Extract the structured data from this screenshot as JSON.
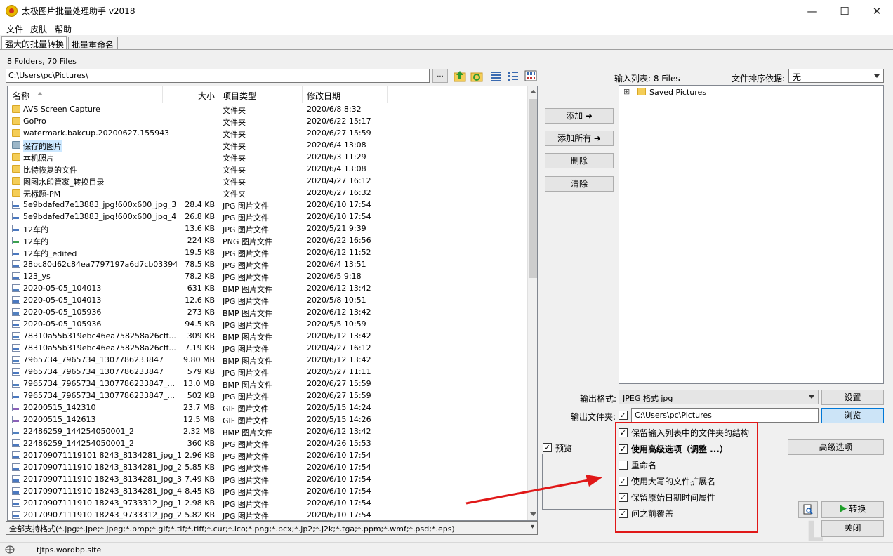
{
  "window": {
    "title": "太极图片批量处理助手  v2018",
    "minimize": "—",
    "maximize": "☐",
    "close": "✕"
  },
  "menu": [
    "文件",
    "皮肤",
    "帮助"
  ],
  "tabs": [
    "强大的批量转换",
    "批量重命名"
  ],
  "file_count": "8 Folders, 70 Files",
  "path": "C:\\Users\\pc\\Pictures\\",
  "browse_small": "...",
  "list": {
    "headers": {
      "name": "名称",
      "size": "大小",
      "type": "项目类型",
      "date": "修改日期"
    },
    "rows": [
      {
        "name": "AVS Screen Capture",
        "size": "",
        "type": "文件夹",
        "date": "2020/6/8 8:32",
        "icon": "folder"
      },
      {
        "name": "GoPro",
        "size": "",
        "type": "文件夹",
        "date": "2020/6/22 15:17",
        "icon": "folder"
      },
      {
        "name": "watermark.bakcup.20200627.155943",
        "size": "",
        "type": "文件夹",
        "date": "2020/6/27 15:59",
        "icon": "folder"
      },
      {
        "name": "保存的图片",
        "size": "",
        "type": "文件夹",
        "date": "2020/6/4 13:08",
        "icon": "folder-grey",
        "selected": true
      },
      {
        "name": "本机照片",
        "size": "",
        "type": "文件夹",
        "date": "2020/6/3 11:29",
        "icon": "folder"
      },
      {
        "name": "比特恢复的文件",
        "size": "",
        "type": "文件夹",
        "date": "2020/6/4 13:08",
        "icon": "folder"
      },
      {
        "name": "图图水印管家_转换目录",
        "size": "",
        "type": "文件夹",
        "date": "2020/4/27 16:12",
        "icon": "folder"
      },
      {
        "name": "无标题-PM",
        "size": "",
        "type": "文件夹",
        "date": "2020/6/27 16:32",
        "icon": "folder"
      },
      {
        "name": "5e9bdafed7e13883_jpg!600x600_jpg_3",
        "size": "28.4 KB",
        "type": "JPG 图片文件",
        "date": "2020/6/10 17:54",
        "icon": "img"
      },
      {
        "name": "5e9bdafed7e13883_jpg!600x600_jpg_4",
        "size": "26.8 KB",
        "type": "JPG 图片文件",
        "date": "2020/6/10 17:54",
        "icon": "img"
      },
      {
        "name": "12车的",
        "size": "13.6 KB",
        "type": "JPG 图片文件",
        "date": "2020/5/21 9:39",
        "icon": "img"
      },
      {
        "name": "12车的",
        "size": "224 KB",
        "type": "PNG 图片文件",
        "date": "2020/6/22 16:56",
        "icon": "png"
      },
      {
        "name": "12车的_edited",
        "size": "19.5 KB",
        "type": "JPG 图片文件",
        "date": "2020/6/12 11:52",
        "icon": "img"
      },
      {
        "name": "28bc80d62c84ea7797197a6d7cb03394",
        "size": "78.5 KB",
        "type": "JPG 图片文件",
        "date": "2020/6/4 13:51",
        "icon": "img"
      },
      {
        "name": "123_ys",
        "size": "78.2 KB",
        "type": "JPG 图片文件",
        "date": "2020/6/5 9:18",
        "icon": "img"
      },
      {
        "name": "2020-05-05_104013",
        "size": "631 KB",
        "type": "BMP 图片文件",
        "date": "2020/6/12 13:42",
        "icon": "bmp"
      },
      {
        "name": "2020-05-05_104013",
        "size": "12.6 KB",
        "type": "JPG 图片文件",
        "date": "2020/5/8 10:51",
        "icon": "img"
      },
      {
        "name": "2020-05-05_105936",
        "size": "273 KB",
        "type": "BMP 图片文件",
        "date": "2020/6/12 13:42",
        "icon": "bmp"
      },
      {
        "name": "2020-05-05_105936",
        "size": "94.5 KB",
        "type": "JPG 图片文件",
        "date": "2020/5/5 10:59",
        "icon": "img"
      },
      {
        "name": "78310a55b319ebc46ea758258a26cff...",
        "size": "309 KB",
        "type": "BMP 图片文件",
        "date": "2020/6/12 13:42",
        "icon": "bmp"
      },
      {
        "name": "78310a55b319ebc46ea758258a26cff...",
        "size": "7.19 KB",
        "type": "JPG 图片文件",
        "date": "2020/4/27 16:12",
        "icon": "img"
      },
      {
        "name": "7965734_7965734_1307786233847",
        "size": "9.80 MB",
        "type": "BMP 图片文件",
        "date": "2020/6/12 13:42",
        "icon": "bmp"
      },
      {
        "name": "7965734_7965734_1307786233847",
        "size": "579 KB",
        "type": "JPG 图片文件",
        "date": "2020/5/27 11:11",
        "icon": "img"
      },
      {
        "name": "7965734_7965734_1307786233847_...",
        "size": "13.0 MB",
        "type": "BMP 图片文件",
        "date": "2020/6/27 15:59",
        "icon": "bmp"
      },
      {
        "name": "7965734_7965734_1307786233847_...",
        "size": "502 KB",
        "type": "JPG 图片文件",
        "date": "2020/6/27 15:59",
        "icon": "img"
      },
      {
        "name": "20200515_142310",
        "size": "23.7 MB",
        "type": "GIF 图片文件",
        "date": "2020/5/15 14:24",
        "icon": "gif"
      },
      {
        "name": "20200515_142613",
        "size": "12.5 MB",
        "type": "GIF 图片文件",
        "date": "2020/5/15 14:26",
        "icon": "gif"
      },
      {
        "name": "22486259_144254050001_2",
        "size": "2.32 MB",
        "type": "BMP 图片文件",
        "date": "2020/6/12 13:42",
        "icon": "bmp"
      },
      {
        "name": "22486259_144254050001_2",
        "size": "360 KB",
        "type": "JPG 图片文件",
        "date": "2020/4/26 15:53",
        "icon": "img"
      },
      {
        "name": "201709071119101 8243_8134281_jpg_1",
        "size": "2.96 KB",
        "type": "JPG 图片文件",
        "date": "2020/6/10 17:54",
        "icon": "img"
      },
      {
        "name": "20170907111910 18243_8134281_jpg_2",
        "size": "5.85 KB",
        "type": "JPG 图片文件",
        "date": "2020/6/10 17:54",
        "icon": "img"
      },
      {
        "name": "20170907111910 18243_8134281_jpg_3",
        "size": "7.49 KB",
        "type": "JPG 图片文件",
        "date": "2020/6/10 17:54",
        "icon": "img"
      },
      {
        "name": "20170907111910 18243_8134281_jpg_4",
        "size": "8.45 KB",
        "type": "JPG 图片文件",
        "date": "2020/6/10 17:54",
        "icon": "img"
      },
      {
        "name": "20170907111910 18243_9733312_jpg_1",
        "size": "2.98 KB",
        "type": "JPG 图片文件",
        "date": "2020/6/10 17:54",
        "icon": "img"
      },
      {
        "name": "20170907111910 18243_9733312_jpg_2",
        "size": "5.82 KB",
        "type": "JPG 图片文件",
        "date": "2020/6/10 17:54",
        "icon": "img"
      }
    ]
  },
  "filter": "全部支持格式(*.jpg;*.jpe;*.jpeg;*.bmp;*.gif;*.tif;*.tiff;*.cur;*.ico;*.png;*.pcx;*.jp2;*.j2k;*.tga;*.ppm;*.wmf;*.psd;*.eps)",
  "actions": {
    "add": "添加 ➜",
    "add_all": "添加所有 ➜",
    "delete": "删除",
    "clear": "清除"
  },
  "input_list": {
    "label": "输入列表: 8 Files",
    "sort_label": "文件排序依据:",
    "sort_value": "无",
    "tree_item": "Saved Pictures",
    "tree_expander": "⊞"
  },
  "output": {
    "format_label": "输出格式:",
    "format_value": "JPEG 格式 jpg",
    "settings": "设置",
    "dir_label": "输出文件夹:",
    "dir_value": "C:\\Users\\pc\\Pictures",
    "browse": "浏览"
  },
  "options": [
    {
      "label": "保留输入列表中的文件夹的结构",
      "checked": true,
      "bold": false
    },
    {
      "label": "使用高级选项（调整 ...）",
      "checked": true,
      "bold": true
    },
    {
      "label": "重命名",
      "checked": false,
      "bold": false
    },
    {
      "label": "使用大写的文件扩展名",
      "checked": true,
      "bold": false
    },
    {
      "label": "保留原始日期时间属性",
      "checked": true,
      "bold": false
    },
    {
      "label": "问之前覆盖",
      "checked": true,
      "bold": false
    }
  ],
  "advanced": "高级选项",
  "preview_label": "预览",
  "convert": "转换",
  "close_btn": "关闭",
  "status": "tjtps.wordbp.site",
  "colors": {
    "annotation_red": "#e01818",
    "selection": "#cce8ff",
    "folder": "#f4cd57"
  }
}
